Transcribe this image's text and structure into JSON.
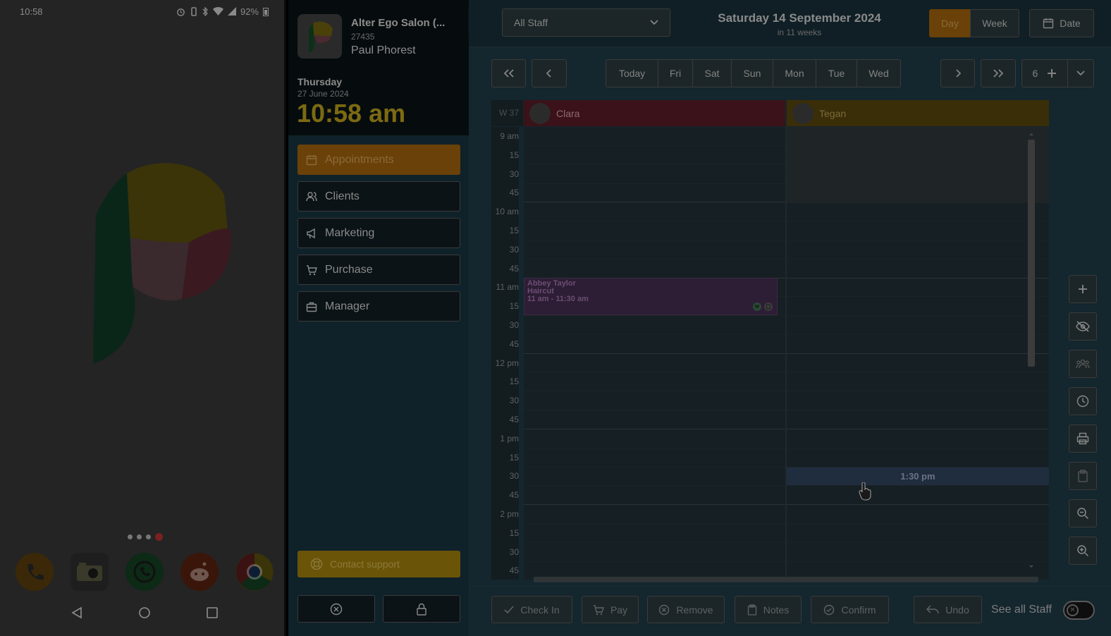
{
  "phone": {
    "time": "10:58",
    "battery": "92%"
  },
  "salon": {
    "name": "Alter Ego Salon (...",
    "code": "27435",
    "user": "Paul Phorest",
    "weekday": "Thursday",
    "date": "27 June 2024",
    "clock": "10:58 am"
  },
  "menu": [
    {
      "label": "Appointments",
      "icon": "calendar-icon",
      "active": true
    },
    {
      "label": "Clients",
      "icon": "people-icon"
    },
    {
      "label": "Marketing",
      "icon": "megaphone-icon"
    },
    {
      "label": "Purchase",
      "icon": "cart-icon"
    },
    {
      "label": "Manager",
      "icon": "briefcase-icon"
    }
  ],
  "support_label": "Contact support",
  "header": {
    "staff_select": "All Staff",
    "date_title": "Saturday 14 September 2024",
    "date_sub": "in 11 weeks",
    "view_day": "Day",
    "view_week": "Week",
    "date_button": "Date"
  },
  "nav": {
    "days": [
      "Today",
      "Fri",
      "Sat",
      "Sun",
      "Mon",
      "Tue",
      "Wed"
    ],
    "count": "6"
  },
  "calendar": {
    "week_label": "W 37",
    "staff": [
      {
        "name": "Clara",
        "color": "#3b1219"
      },
      {
        "name": "Tegan",
        "color": "#3a2e08"
      }
    ],
    "time_labels": [
      "9 am",
      "15",
      "30",
      "45",
      "10 am",
      "15",
      "30",
      "45",
      "11 am",
      "15",
      "30",
      "45",
      "12 pm",
      "15",
      "30",
      "45",
      "1 pm",
      "15",
      "30",
      "45",
      "2 pm",
      "15",
      "30",
      "45"
    ],
    "appointment": {
      "client": "Abbey Taylor",
      "service": "Haircut",
      "time": "11 am - 11:30 am"
    },
    "hover_slot": "1:30 pm"
  },
  "actions": {
    "check_in": "Check In",
    "pay": "Pay",
    "remove": "Remove",
    "notes": "Notes",
    "confirm": "Confirm",
    "undo": "Undo",
    "see_all": "See all Staff"
  }
}
